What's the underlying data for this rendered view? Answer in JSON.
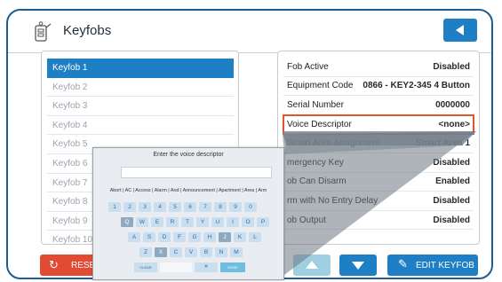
{
  "header": {
    "title": "Keyfobs"
  },
  "keyfobs": [
    "Keyfob 1",
    "Keyfob 2",
    "Keyfob 3",
    "Keyfob 4",
    "Keyfob 5",
    "Keyfob 6",
    "Keyfob 7",
    "Keyfob 8",
    "Keyfob 9",
    "Keyfob 10"
  ],
  "properties": [
    {
      "label": "Fob Active",
      "value": "Disabled"
    },
    {
      "label": "Equipment Code",
      "value": "0866 - KEY2-345 4 Button"
    },
    {
      "label": "Serial Number",
      "value": "0000000"
    },
    {
      "label": "Voice Descriptor",
      "value": "<none>"
    },
    {
      "label": "Smart Area Assignment",
      "value": "Smart Area 1"
    },
    {
      "label": "mergency Key",
      "value": "Disabled"
    },
    {
      "label": "ob Can Disarm",
      "value": "Enabled"
    },
    {
      "label": "rm with No Entry Delay",
      "value": "Disabled"
    },
    {
      "label": "ob Output",
      "value": "Disabled"
    }
  ],
  "buttons": {
    "reset": "RESE",
    "edit": "EDIT KEYFOB"
  },
  "keyboard": {
    "title": "Enter the voice descriptor",
    "input_value": "",
    "suggestions": "Abort | AC | Access | Alarm | And | Announcement | Apartment | Area | Arm",
    "row1": [
      "1",
      "2",
      "3",
      "4",
      "5",
      "6",
      "7",
      "8",
      "9",
      "0"
    ],
    "row2": [
      "Q",
      "W",
      "E",
      "R",
      "T",
      "Y",
      "U",
      "I",
      "O",
      "P"
    ],
    "row3": [
      "A",
      "S",
      "D",
      "F",
      "G",
      "H",
      "J",
      "K",
      "L"
    ],
    "row4": [
      "Z",
      "X",
      "C",
      "V",
      "B",
      "N",
      "M"
    ],
    "clear": "CLEAR",
    "delete": "✕",
    "done": "DONE"
  },
  "colors": {
    "accent": "#1f7fc4",
    "frame": "#1d5d8f",
    "reset": "#e24a34",
    "highlight": "#e4532b"
  },
  "icons": {
    "header": "keyfob-icon",
    "back": "back-arrow-icon",
    "reset": "refresh-icon",
    "edit": "pencil-icon"
  }
}
